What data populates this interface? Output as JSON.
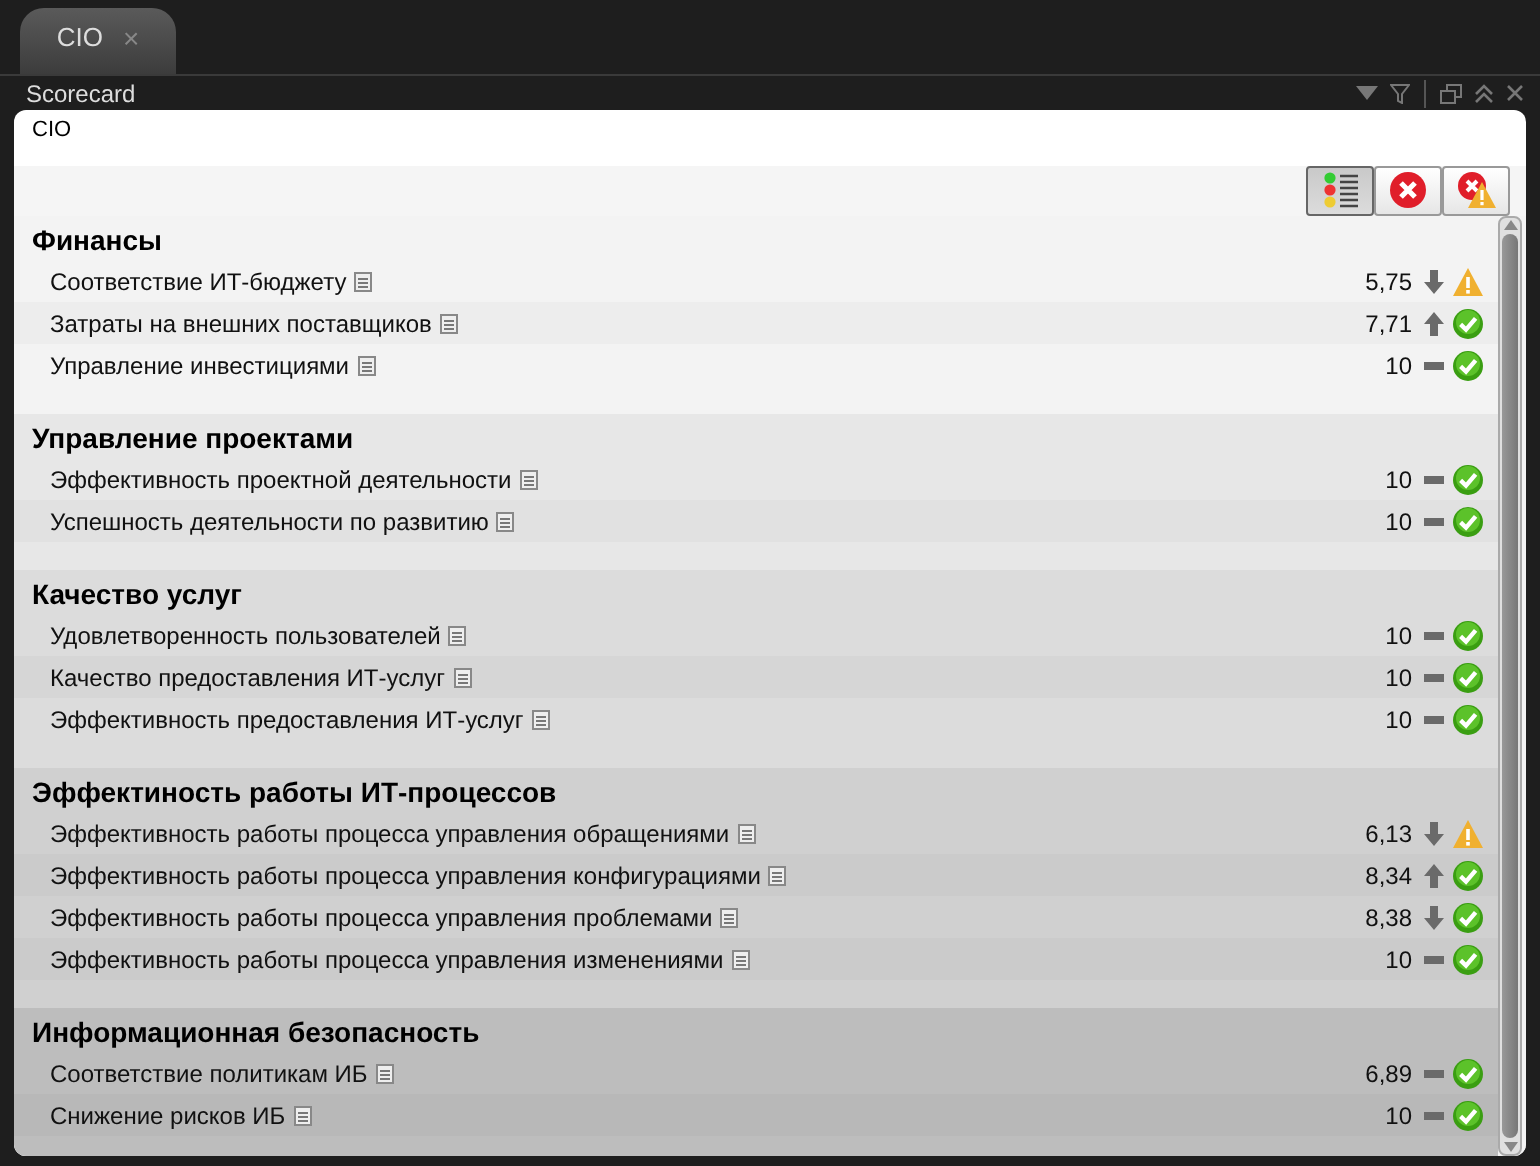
{
  "tab": {
    "label": "CIO",
    "close": "×"
  },
  "panel": {
    "title": "Scorecard"
  },
  "scorecard": {
    "title": "CIO",
    "toolbar": [
      {
        "kind": "traffic",
        "selected": true
      },
      {
        "kind": "error",
        "selected": false
      },
      {
        "kind": "warnerror",
        "selected": false
      }
    ],
    "sections": [
      {
        "title": "Финансы",
        "items": [
          {
            "name": "Соответствие ИТ-бюджету",
            "value": "5,75",
            "trend": {
              "kind": "down"
            },
            "status": {
              "kind": "warning"
            }
          },
          {
            "name": "Затраты на внешних поставщиков",
            "value": "7,71",
            "trend": {
              "kind": "up"
            },
            "status": {
              "kind": "ok"
            }
          },
          {
            "name": "Управление инвестициями",
            "value": "10",
            "trend": {
              "kind": "flat"
            },
            "status": {
              "kind": "ok"
            }
          }
        ]
      },
      {
        "title": "Управление проектами",
        "items": [
          {
            "name": "Эффективность проектной деятельности",
            "value": "10",
            "trend": {
              "kind": "flat"
            },
            "status": {
              "kind": "ok"
            }
          },
          {
            "name": "Успешность деятельности по развитию",
            "value": "10",
            "trend": {
              "kind": "flat"
            },
            "status": {
              "kind": "ok"
            }
          }
        ]
      },
      {
        "title": "Качество услуг",
        "items": [
          {
            "name": "Удовлетворенность пользователей",
            "value": "10",
            "trend": {
              "kind": "flat"
            },
            "status": {
              "kind": "ok"
            }
          },
          {
            "name": "Качество предоставления ИТ-услуг",
            "value": "10",
            "trend": {
              "kind": "flat"
            },
            "status": {
              "kind": "ok"
            }
          },
          {
            "name": "Эффективность предоставления ИТ-услуг",
            "value": "10",
            "trend": {
              "kind": "flat"
            },
            "status": {
              "kind": "ok"
            }
          }
        ]
      },
      {
        "title": "Эффектиность работы ИТ-процессов",
        "items": [
          {
            "name": "Эффективность работы процесса управления обращениями",
            "value": "6,13",
            "trend": {
              "kind": "down"
            },
            "status": {
              "kind": "warning"
            }
          },
          {
            "name": "Эффективность работы процесса управления конфигурациями",
            "value": "8,34",
            "trend": {
              "kind": "up"
            },
            "status": {
              "kind": "ok"
            }
          },
          {
            "name": "Эффективность работы процесса управления проблемами",
            "value": "8,38",
            "trend": {
              "kind": "down"
            },
            "status": {
              "kind": "ok"
            }
          },
          {
            "name": "Эффективность работы процесса управления изменениями",
            "value": "10",
            "trend": {
              "kind": "flat"
            },
            "status": {
              "kind": "ok"
            }
          }
        ]
      },
      {
        "title": "Информационная безопасность",
        "items": [
          {
            "name": "Соответствие политикам ИБ",
            "value": "6,89",
            "trend": {
              "kind": "flat"
            },
            "status": {
              "kind": "ok"
            }
          },
          {
            "name": "Снижение рисков ИБ",
            "value": "10",
            "trend": {
              "kind": "flat"
            },
            "status": {
              "kind": "ok"
            }
          }
        ]
      }
    ]
  }
}
